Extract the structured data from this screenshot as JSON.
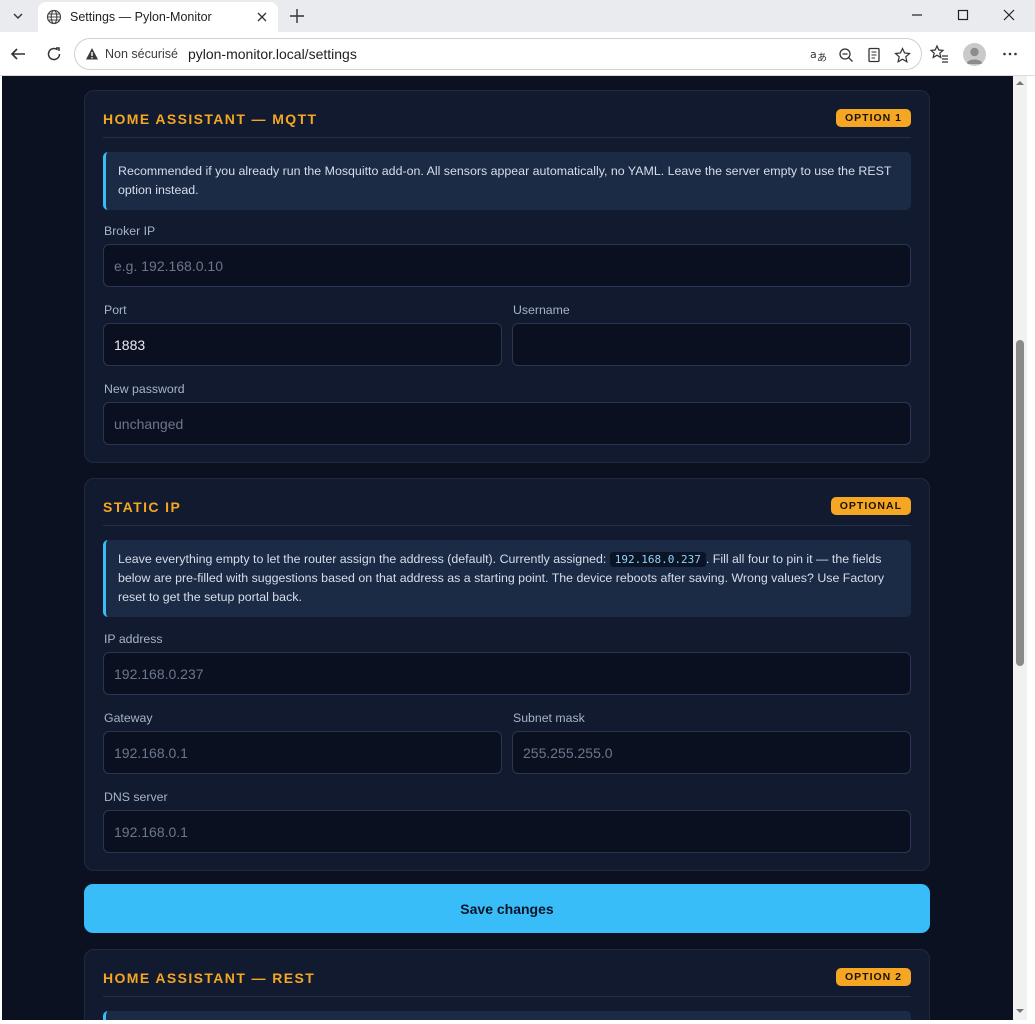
{
  "browser": {
    "tab_title": "Settings — Pylon-Monitor",
    "security_label": "Non sécurisé",
    "url": "pylon-monitor.local/settings"
  },
  "mqtt": {
    "title": "HOME ASSISTANT — MQTT",
    "badge": "OPTION 1",
    "info": "Recommended if you already run the Mosquitto add-on. All sensors appear automatically, no YAML. Leave the server empty to use the REST option instead.",
    "broker_label": "Broker IP",
    "broker_placeholder": "e.g. 192.168.0.10",
    "port_label": "Port",
    "port_value": "1883",
    "username_label": "Username",
    "username_value": "",
    "password_label": "New password",
    "password_placeholder": "unchanged"
  },
  "static_ip": {
    "title": "STATIC IP",
    "badge": "OPTIONAL",
    "info_before": "Leave everything empty to let the router assign the address (default). Currently assigned: ",
    "info_code": "192.168.0.237",
    "info_after": ". Fill all four to pin it — the fields below are pre-filled with suggestions based on that address as a starting point. The device reboots after saving. Wrong values? Use Factory reset to get the setup portal back.",
    "ip_label": "IP address",
    "ip_placeholder": "192.168.0.237",
    "gateway_label": "Gateway",
    "gateway_placeholder": "192.168.0.1",
    "subnet_label": "Subnet mask",
    "subnet_placeholder": "255.255.255.0",
    "dns_label": "DNS server",
    "dns_placeholder": "192.168.0.1"
  },
  "save_label": "Save changes",
  "rest": {
    "title": "HOME ASSISTANT — REST",
    "badge": "OPTION 2"
  },
  "colors": {
    "accent": "#f5a623",
    "primary": "#38bdf8",
    "background": "#0b1120",
    "card": "#111a2e"
  }
}
